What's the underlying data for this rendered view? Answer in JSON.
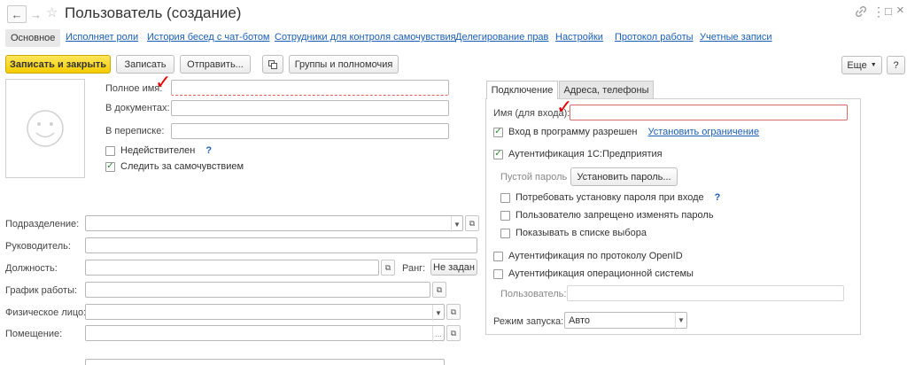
{
  "window": {
    "title": "Пользователь (создание)"
  },
  "nav": {
    "back": "←",
    "forward": "→",
    "star": "☆"
  },
  "window_icons": {
    "link": "🔗",
    "more": "⋮",
    "maximize": "□",
    "close": "×"
  },
  "tabs": [
    "Основное",
    "Исполняет роли",
    "История бесед с чат-ботом",
    "Сотрудники для контроля самочувствия",
    "Делегирование прав",
    "Настройки",
    "Протокол работы",
    "Учетные записи"
  ],
  "toolbar": {
    "save_close": "Записать и закрыть",
    "save": "Записать",
    "send": "Отправить...",
    "groups": "Группы и полномочия",
    "more": "Еще",
    "help": "?"
  },
  "left": {
    "full_name_label": "Полное имя:",
    "full_name_value": "",
    "in_docs_label": "В документах:",
    "in_docs_value": "",
    "in_corr_label": "В переписке:",
    "in_corr_value": "",
    "invalid_label": "Недействителен",
    "invalid_checked": false,
    "wellbeing_label": "Следить за самочувствием",
    "wellbeing_checked": true,
    "help": "?"
  },
  "form": {
    "division_label": "Подразделение:",
    "manager_label": "Руководитель:",
    "position_label": "Должность:",
    "rank_label": "Ранг:",
    "rank_value": "Не задан",
    "schedule_label": "График работы:",
    "person_label": "Физическое лицо:",
    "room_label": "Помещение:"
  },
  "right": {
    "tab_connection": "Подключение",
    "tab_addresses": "Адреса, телефоны",
    "login_label": "Имя (для входа):",
    "login_value": "",
    "login_allowed_label": "Вход в программу разрешен",
    "login_allowed_checked": true,
    "set_restriction": "Установить ограничение",
    "auth_1c_label": "Аутентификация 1С:Предприятия",
    "auth_1c_checked": true,
    "empty_password": "Пустой пароль",
    "set_password": "Установить пароль...",
    "require_password_label": "Потребовать установку пароля при входе",
    "require_password_checked": false,
    "deny_change_label": "Пользователю запрещено изменять пароль",
    "deny_change_checked": false,
    "show_in_list_label": "Показывать в списке выбора",
    "show_in_list_checked": false,
    "openid_label": "Аутентификация по протоколу OpenID",
    "openid_checked": false,
    "os_auth_label": "Аутентификация операционной системы",
    "os_auth_checked": false,
    "user_label": "Пользователь:",
    "launch_mode_label": "Режим запуска:",
    "launch_mode_value": "Авто",
    "help": "?"
  },
  "colors": {
    "link": "#1a5fb4",
    "primary": "#f5cc00",
    "annotation": "#e30000"
  }
}
